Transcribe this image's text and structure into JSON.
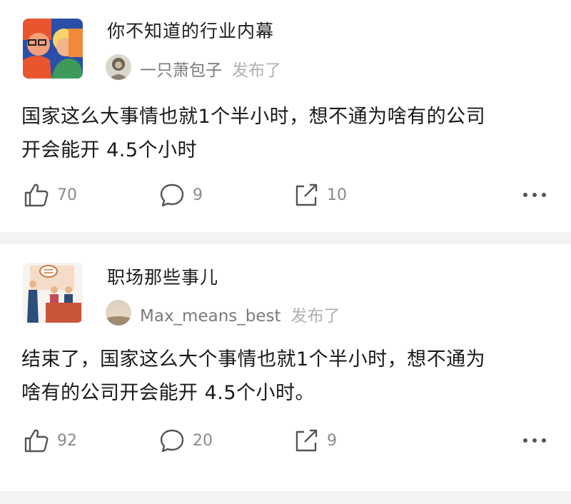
{
  "posts": [
    {
      "group": "你不知道的行业内幕",
      "author": "一只萧包子",
      "published_label": "发布了",
      "text_lines": [
        "国家这么大事情也就1个半小时，想不通为啥有的公司",
        "开会能开 4.5个小时"
      ],
      "likes": "70",
      "comments": "9",
      "shares": "10"
    },
    {
      "group": "职场那些事儿",
      "author": "Max_means_best",
      "published_label": "发布了",
      "text_lines": [
        "结束了，国家这么大个事情也就1个半小时，想不通为",
        "啥有的公司开会能开 4.5个小时。"
      ],
      "likes": "92",
      "comments": "20",
      "shares": "9"
    }
  ],
  "icons": {
    "like": "thumbs-up-icon",
    "comment": "comment-bubble-icon",
    "share": "share-icon",
    "more": "more-dots-icon"
  },
  "colors": {
    "text": "#1a1a1a",
    "secondary": "#7a7a7a",
    "muted": "#b0b0b0",
    "separator": "#f3f3f3"
  }
}
